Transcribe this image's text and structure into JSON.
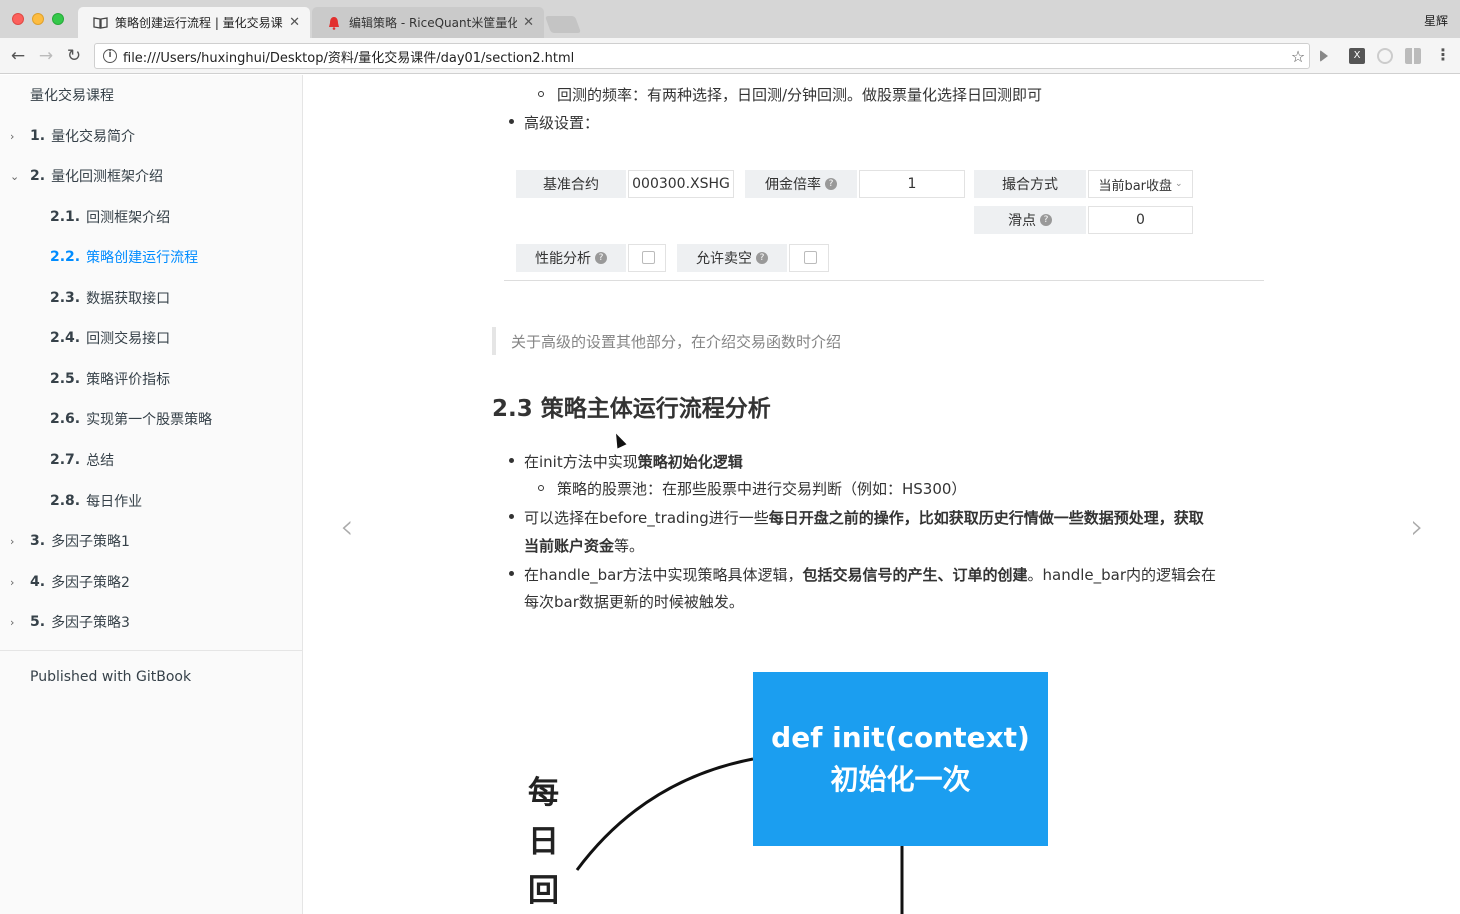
{
  "browser": {
    "tabs": [
      {
        "title": "策略创建运行流程 | 量化交易课",
        "active": true
      },
      {
        "title": "编辑策略 - RiceQuant米筐量化",
        "active": false
      }
    ],
    "profile_name": "星辉",
    "url": "file:///Users/huxinghui/Desktop/资料/量化交易课件/day01/section2.html"
  },
  "sidebar": {
    "title": "量化交易课程",
    "items": [
      {
        "num": "1.",
        "label": "量化交易简介",
        "caret": "›"
      },
      {
        "num": "2.",
        "label": "量化回测框架介绍",
        "caret": "⌄"
      },
      {
        "num": "2.1.",
        "label": "回测框架介绍"
      },
      {
        "num": "2.2.",
        "label": "策略创建运行流程"
      },
      {
        "num": "2.3.",
        "label": "数据获取接口"
      },
      {
        "num": "2.4.",
        "label": "回测交易接口"
      },
      {
        "num": "2.5.",
        "label": "策略评价指标"
      },
      {
        "num": "2.6.",
        "label": "实现第一个股票策略"
      },
      {
        "num": "2.7.",
        "label": "总结"
      },
      {
        "num": "2.8.",
        "label": "每日作业"
      },
      {
        "num": "3.",
        "label": "多因子策略1",
        "caret": "›"
      },
      {
        "num": "4.",
        "label": "多因子策略2",
        "caret": "›"
      },
      {
        "num": "5.",
        "label": "多因子策略3",
        "caret": "›"
      }
    ],
    "footer": "Published with GitBook"
  },
  "content": {
    "freq_item": "回测的频率：有两种选择，日回测/分钟回测。做股票量化选择日回测即可",
    "advanced_item": "高级设置：",
    "settings": {
      "benchmark_label": "基准合约",
      "benchmark_value": "000300.XSHG",
      "commission_label": "佣金倍率",
      "commission_value": "1",
      "matching_label": "撮合方式",
      "matching_value": "当前bar收盘",
      "slippage_label": "滑点",
      "slippage_value": "0",
      "perf_label": "性能分析",
      "short_label": "允许卖空"
    },
    "quote": "关于高级的设置其他部分，在介绍交易函数时介绍",
    "heading": "2.3 策略主体运行流程分析",
    "b1_pre": "在init方法中实现",
    "b1_bold": "策略初始化逻辑",
    "b1_sub": "策略的股票池：在那些股票中进行交易判断（例如：HS300）",
    "b2_pre": "可以选择在before_trading进行一些",
    "b2_bold_1": "每日开盘之前的操作，比如获取历史行情做一些数据预处理，获取",
    "b2_bold_2": "当前账户资金",
    "b2_post": "等。",
    "b3_pre": "在handle_bar方法中实现策略具体逻辑，",
    "b3_bold": "包括交易信号的产生、订单的创建",
    "b3_post": "。handle_bar内的逻辑会在",
    "b3_line2": "每次bar数据更新的时候被触发。",
    "diagram": {
      "box_line1": "def  init(context)",
      "box_line2": "初始化一次",
      "side_chars": [
        "每",
        "日",
        "回"
      ]
    }
  },
  "icons": {
    "prev": "‹",
    "next": "›"
  }
}
